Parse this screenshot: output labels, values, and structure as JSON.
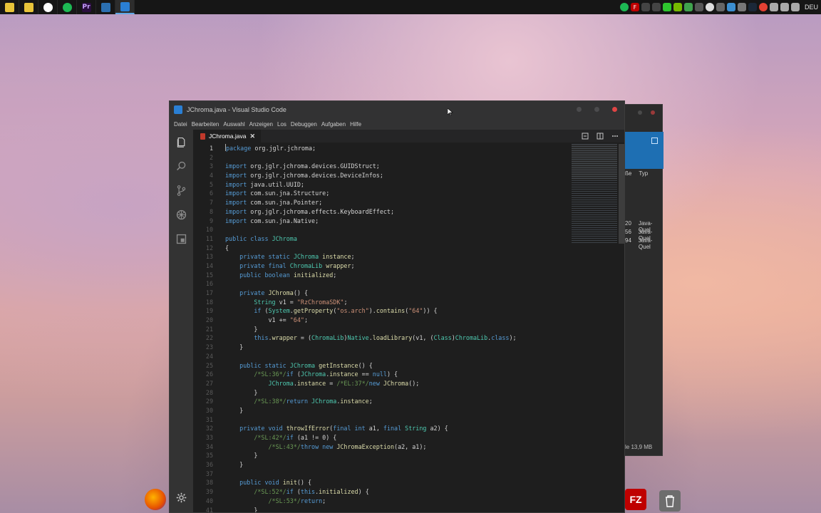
{
  "taskbar": {
    "apps": [
      {
        "icon": "sticky-icon",
        "label": "",
        "color": "#e8c43a"
      },
      {
        "icon": "folder-icon",
        "label": "",
        "color": "#e8c43a"
      },
      {
        "icon": "mail-icon",
        "label": "",
        "color": "#ffffff"
      },
      {
        "icon": "spotify-icon",
        "label": "",
        "color": "#1db954"
      },
      {
        "icon": "premiere-icon",
        "label": "Pr",
        "color": "#2a0e3e"
      },
      {
        "icon": "app-icon",
        "label": "",
        "color": "#2b6fb0"
      },
      {
        "icon": "vscode-icon",
        "label": "",
        "color": "#2a7fd4"
      }
    ],
    "language": "DEU"
  },
  "explorer": {
    "columns": [
      "ße",
      "Typ"
    ],
    "rows": [
      {
        "size": "20",
        "type": "Java-Quel"
      },
      {
        "size": "56",
        "type": "Java-Quel"
      },
      {
        "size": "94",
        "type": "Java-Quel"
      }
    ],
    "status": "le 13,9 MB"
  },
  "window": {
    "title": "JChroma.java - Visual Studio Code"
  },
  "menu": [
    "Datei",
    "Bearbeiten",
    "Auswahl",
    "Anzeigen",
    "Los",
    "Debuggen",
    "Aufgaben",
    "Hilfe"
  ],
  "tab": {
    "label": "JChroma.java",
    "close": "✕"
  },
  "code_lines": [
    {
      "n": "1",
      "html": "<span class=\"caret\"></span><span class=\"kw\">package</span> org.jglr.jchroma;"
    },
    {
      "n": "2",
      "html": ""
    },
    {
      "n": "3",
      "html": "<span class=\"kw\">import</span> org.jglr.jchroma.devices.GUIDStruct;"
    },
    {
      "n": "4",
      "html": "<span class=\"kw\">import</span> org.jglr.jchroma.devices.DeviceInfos;"
    },
    {
      "n": "5",
      "html": "<span class=\"kw\">import</span> java.util.UUID;"
    },
    {
      "n": "6",
      "html": "<span class=\"kw\">import</span> com.sun.jna.Structure;"
    },
    {
      "n": "7",
      "html": "<span class=\"kw\">import</span> com.sun.jna.Pointer;"
    },
    {
      "n": "8",
      "html": "<span class=\"kw\">import</span> org.jglr.jchroma.effects.KeyboardEffect;"
    },
    {
      "n": "9",
      "html": "<span class=\"kw\">import</span> com.sun.jna.Native;"
    },
    {
      "n": "10",
      "html": ""
    },
    {
      "n": "11",
      "html": "<span class=\"kw\">public class</span> <span class=\"ty\">JChroma</span>"
    },
    {
      "n": "12",
      "html": "{"
    },
    {
      "n": "13",
      "html": "    <span class=\"kw\">private static</span> <span class=\"ty\">JChroma</span> <span class=\"fn\">instance</span>;"
    },
    {
      "n": "14",
      "html": "    <span class=\"kw\">private final</span> <span class=\"ty\">ChromaLib</span> <span class=\"fn\">wrapper</span>;"
    },
    {
      "n": "15",
      "html": "    <span class=\"kw\">public boolean</span> <span class=\"fn\">initialized</span>;"
    },
    {
      "n": "16",
      "html": ""
    },
    {
      "n": "17",
      "html": "    <span class=\"kw\">private</span> <span class=\"fn\">JChroma</span>() {"
    },
    {
      "n": "18",
      "html": "        <span class=\"ty\">String</span> v1 = <span class=\"str\">\"RzChromaSDK\"</span>;"
    },
    {
      "n": "19",
      "html": "        <span class=\"kw\">if</span> (<span class=\"ty\">System</span>.<span class=\"fn\">getProperty</span>(<span class=\"str\">\"os.arch\"</span>).<span class=\"fn\">contains</span>(<span class=\"str\">\"64\"</span>)) {"
    },
    {
      "n": "20",
      "html": "            v1 += <span class=\"str\">\"64\"</span>;"
    },
    {
      "n": "21",
      "html": "        }"
    },
    {
      "n": "22",
      "html": "        <span class=\"kw\">this</span>.<span class=\"fn\">wrapper</span> = (<span class=\"ty\">ChromaLib</span>)<span class=\"ty\">Native</span>.<span class=\"fn\">loadLibrary</span>(v1, (<span class=\"ty\">Class</span>)<span class=\"ty\">ChromaLib</span>.<span class=\"kw\">class</span>);"
    },
    {
      "n": "23",
      "html": "    }"
    },
    {
      "n": "24",
      "html": ""
    },
    {
      "n": "25",
      "html": "    <span class=\"kw\">public static</span> <span class=\"ty\">JChroma</span> <span class=\"fn\">getInstance</span>() {"
    },
    {
      "n": "26",
      "html": "        <span class=\"cm\">/*SL:36*/</span><span class=\"kw\">if</span> (<span class=\"ty\">JChroma</span>.<span class=\"fn\">instance</span> == <span class=\"kw\">null</span>) {"
    },
    {
      "n": "27",
      "html": "            <span class=\"ty\">JChroma</span>.<span class=\"fn\">instance</span> = <span class=\"cm\">/*EL:37*/</span><span class=\"kw\">new</span> <span class=\"fn\">JChroma</span>();"
    },
    {
      "n": "28",
      "html": "        }"
    },
    {
      "n": "29",
      "html": "        <span class=\"cm\">/*SL:38*/</span><span class=\"kw\">return</span> <span class=\"ty\">JChroma</span>.<span class=\"fn\">instance</span>;"
    },
    {
      "n": "30",
      "html": "    }"
    },
    {
      "n": "31",
      "html": ""
    },
    {
      "n": "32",
      "html": "    <span class=\"kw\">private void</span> <span class=\"fn\">throwIfError</span>(<span class=\"kw\">final int</span> a1, <span class=\"kw\">final</span> <span class=\"ty\">String</span> a2) {"
    },
    {
      "n": "33",
      "html": "        <span class=\"cm\">/*SL:42*/</span><span class=\"kw\">if</span> (a1 != 0) {"
    },
    {
      "n": "34",
      "html": "            <span class=\"cm\">/*SL:43*/</span><span class=\"kw\">throw new</span> <span class=\"fn\">JChromaException</span>(a2, a1);"
    },
    {
      "n": "35",
      "html": "        }"
    },
    {
      "n": "36",
      "html": "    }"
    },
    {
      "n": "37",
      "html": ""
    },
    {
      "n": "38",
      "html": "    <span class=\"kw\">public void</span> <span class=\"fn\">init</span>() {"
    },
    {
      "n": "39",
      "html": "        <span class=\"cm\">/*SL:52*/</span><span class=\"kw\">if</span> (<span class=\"kw\">this</span>.<span class=\"fn\">initialized</span>) {"
    },
    {
      "n": "40",
      "html": "            <span class=\"cm\">/*SL:53*/</span><span class=\"kw\">return</span>;"
    },
    {
      "n": "41",
      "html": "        }"
    }
  ],
  "dock": {
    "filezilla_label": "FZ"
  },
  "colors": {
    "accent": "#2a7fd4",
    "close": "#e04545",
    "keyword": "#569cd6",
    "type": "#4ec9b0",
    "string": "#ce9178",
    "comment": "#6a9955",
    "function": "#dcdcaa"
  }
}
